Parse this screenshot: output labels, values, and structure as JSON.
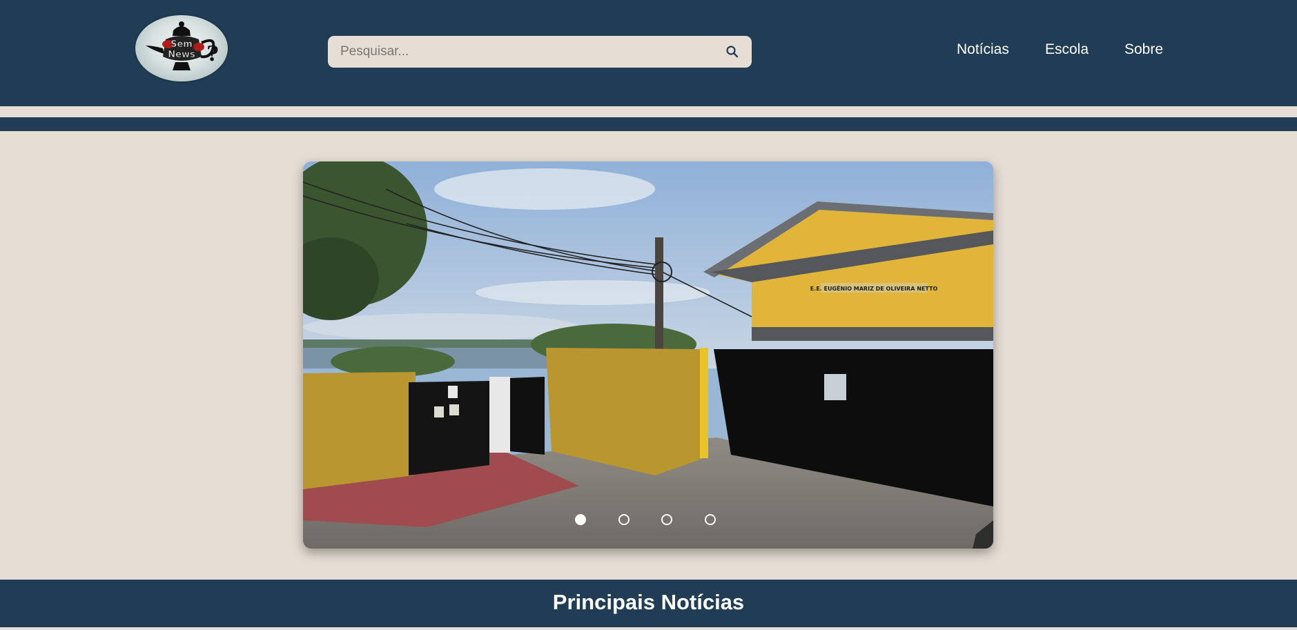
{
  "header": {
    "logo": {
      "logo_text_top": "Sem",
      "logo_text_bottom": "News",
      "accent_red": "#b01c1c"
    },
    "search": {
      "placeholder": "Pesquisar...",
      "value": "",
      "icon": "search-icon"
    },
    "nav": [
      {
        "label": "Notícias"
      },
      {
        "label": "Escola"
      },
      {
        "label": "Sobre"
      }
    ]
  },
  "carousel": {
    "image_sign_text": "E.E. EUGÊNIO MARIZ DE OLIVEIRA NETTO",
    "slides_count": 4,
    "active_slide": 1
  },
  "main": {
    "section_title": "Principais Notícias"
  },
  "colors": {
    "primary_dark": "#203d55",
    "background": "#e6ddd4",
    "text_light": "#ffffff"
  }
}
